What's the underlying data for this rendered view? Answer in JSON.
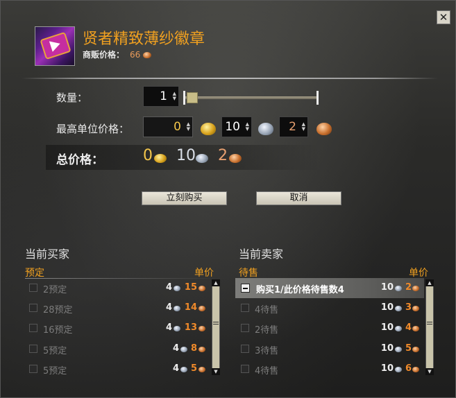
{
  "window": {
    "close_label": "✕"
  },
  "item": {
    "title": "贤者精致薄纱徽章",
    "vendor_price_label": "商贩价格：",
    "vendor_price_value": "66",
    "icon_name": "insignia-icon"
  },
  "form": {
    "quantity_label": "数量：",
    "quantity_value": "1",
    "quantity_slider_fraction": 0.0,
    "max_price_label": "最高单位价格：",
    "gold_value": "0",
    "silver_value": "10",
    "copper_value": "2",
    "total_label": "总价格：",
    "total_gold": "0",
    "total_silver": "10",
    "total_copper": "2"
  },
  "buttons": {
    "buy_now": "立刻购买",
    "cancel": "取消"
  },
  "buyers": {
    "title": "当前买家",
    "col_left": "预定",
    "col_right": "单价",
    "rows": [
      {
        "label": "2预定",
        "silver": "4",
        "copper": "15"
      },
      {
        "label": "28预定",
        "silver": "4",
        "copper": "14"
      },
      {
        "label": "16预定",
        "silver": "4",
        "copper": "13"
      },
      {
        "label": "5预定",
        "silver": "4",
        "copper": "8"
      },
      {
        "label": "5预定",
        "silver": "4",
        "copper": "5"
      }
    ]
  },
  "sellers": {
    "title": "当前卖家",
    "col_left": "待售",
    "col_right": "单价",
    "rows": [
      {
        "label": "购买1/此价格待售数4",
        "silver": "10",
        "copper": "2",
        "selected": true
      },
      {
        "label": "4待售",
        "silver": "10",
        "copper": "3"
      },
      {
        "label": "2待售",
        "silver": "10",
        "copper": "4"
      },
      {
        "label": "3待售",
        "silver": "10",
        "copper": "5"
      },
      {
        "label": "4待售",
        "silver": "10",
        "copper": "6"
      }
    ]
  },
  "colors": {
    "accent_orange": "#f0a020",
    "copper": "#f08a2a",
    "gold": "#f3c64b",
    "silver": "#d8dde5"
  }
}
